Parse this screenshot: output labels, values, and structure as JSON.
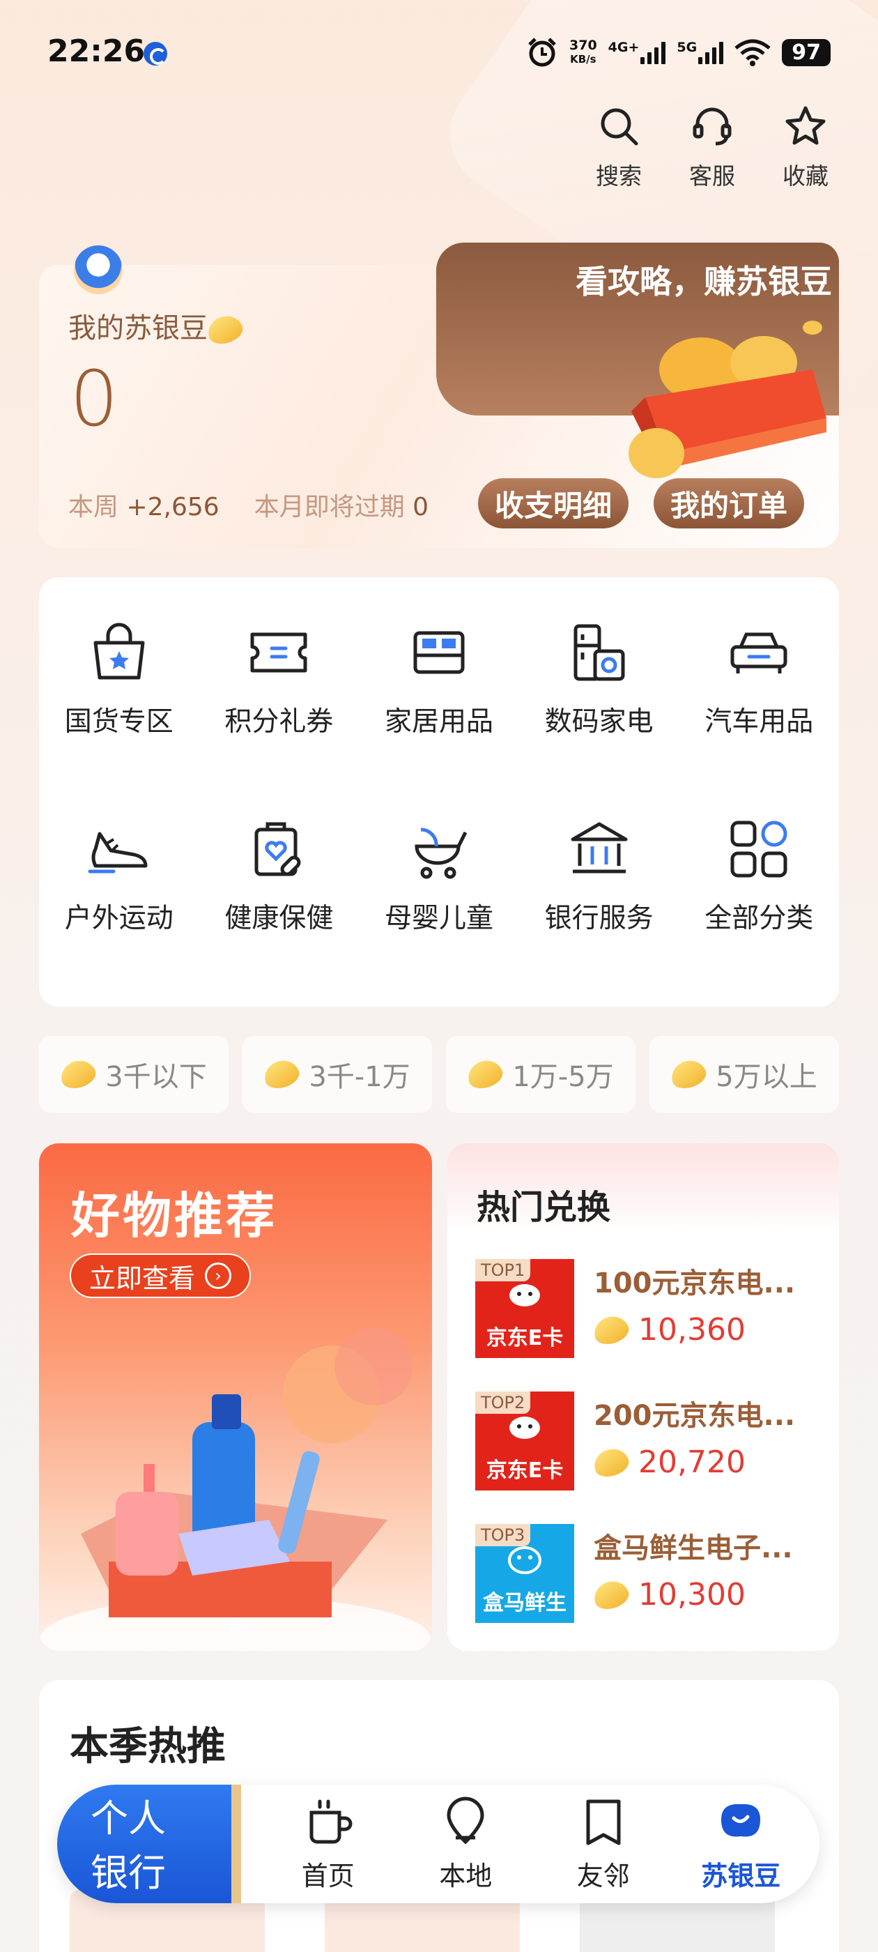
{
  "status_bar": {
    "time": "22:26",
    "net_speed": "370",
    "net_speed_unit": "KB/s",
    "net_type_1": "4G+",
    "net_type_2": "5G",
    "battery": "97"
  },
  "top_actions": [
    {
      "label": "搜索",
      "icon": "search-icon"
    },
    {
      "label": "客服",
      "icon": "headset-icon"
    },
    {
      "label": "收藏",
      "icon": "star-icon"
    }
  ],
  "bean_card": {
    "title": "我的苏银豆",
    "amount": "0",
    "week_label": "本周",
    "week_value": "+2,656",
    "expire_label": "本月即将过期",
    "expire_value": "0",
    "promo_text": "看攻略，赚苏银豆",
    "detail_button": "收支明细",
    "orders_button": "我的订单"
  },
  "categories": [
    {
      "label": "国货专区",
      "icon": "shopping-bag-icon"
    },
    {
      "label": "积分礼券",
      "icon": "ticket-icon"
    },
    {
      "label": "家居用品",
      "icon": "bed-icon"
    },
    {
      "label": "数码家电",
      "icon": "appliance-icon"
    },
    {
      "label": "汽车用品",
      "icon": "car-icon"
    },
    {
      "label": "户外运动",
      "icon": "sneaker-icon"
    },
    {
      "label": "健康保健",
      "icon": "health-kit-icon"
    },
    {
      "label": "母婴儿童",
      "icon": "stroller-icon"
    },
    {
      "label": "银行服务",
      "icon": "bank-icon"
    },
    {
      "label": "全部分类",
      "icon": "grid-icon"
    }
  ],
  "price_filters": [
    "3千以下",
    "3千-1万",
    "1万-5万",
    "5万以上"
  ],
  "promo": {
    "title": "好物推荐",
    "button": "立即查看"
  },
  "hot": {
    "title": "热门兑换",
    "items": [
      {
        "rank": "TOP1",
        "brand": "京东E卡",
        "name": "100元京东电...",
        "price": "10,360"
      },
      {
        "rank": "TOP2",
        "brand": "京东E卡",
        "name": "200元京东电...",
        "price": "20,720"
      },
      {
        "rank": "TOP3",
        "brand": "盒马鲜生",
        "name": "盒马鲜生电子...",
        "price": "10,300"
      }
    ]
  },
  "season": {
    "title": "本季热推"
  },
  "bottom_nav": {
    "personal_line1": "个人",
    "personal_line2": "银行",
    "items": [
      {
        "label": "首页",
        "icon": "cup-icon"
      },
      {
        "label": "本地",
        "icon": "location-icon"
      },
      {
        "label": "友邻",
        "icon": "bookmark-icon"
      },
      {
        "label": "苏银豆",
        "icon": "bean-icon"
      }
    ]
  },
  "colors": {
    "brand_blue": "#1a56d6",
    "bean_brown": "#9b5e36",
    "price_red": "#e23c34"
  }
}
